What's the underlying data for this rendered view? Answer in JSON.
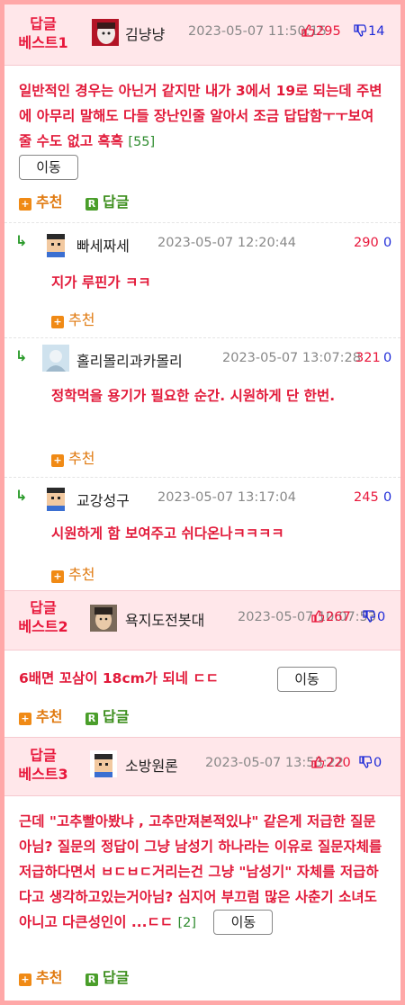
{
  "best1": {
    "label": "답글\n베스트1",
    "nick": "김냥냥",
    "time": "2023-05-07 11:50:15",
    "up": "295",
    "down": "14",
    "text": "일반적인 경우는 아닌거 같지만 내가 3에서 19로 되는데 주변에 아무리 말해도 다들 장난인줄 알아서 조금 답답함ㅜㅜ보여줄 수도 없고 흑흑",
    "count": "[55]",
    "move": "이동",
    "rec": "추천",
    "reply": "답글"
  },
  "replies": [
    {
      "nick": "빠세짜세",
      "time": "2023-05-07 12:20:44",
      "up": "290",
      "down": "0",
      "text": "지가 루핀가 ㅋㅋ",
      "rec": "추천"
    },
    {
      "nick": "홀리몰리과카몰리",
      "time": "2023-05-07 13:07:28",
      "up": "321",
      "down": "0",
      "text": "정학먹을 용기가 필요한 순간. 시원하게 단 한번.",
      "rec": "추천"
    },
    {
      "nick": "교강성구",
      "time": "2023-05-07 13:17:04",
      "up": "245",
      "down": "0",
      "text": "시원하게 함 보여주고 쉬다온나ㅋㅋㅋㅋ",
      "rec": "추천"
    }
  ],
  "best2": {
    "label": "답글\n베스트2",
    "nick": "욕지도전봇대",
    "time": "2023-05-07 10:07:53",
    "up": "267",
    "down": "0",
    "text": "6배면 꼬삼이 18cm가 되네 ㄷㄷ",
    "move": "이동",
    "rec": "추천",
    "reply": "답글"
  },
  "best3": {
    "label": "답글\n베스트3",
    "nick": "소방원론",
    "time": "2023-05-07 13:53:22",
    "up": "220",
    "down": "0",
    "text": "근데 \"고추빨아봤냐 , 고추만져본적있냐\" 같은게 저급한 질문아님? 질문의 정답이 그냥 남성기 하나라는 이유로 질문자체를 저급하다면서 ㅂㄷㅂㄷ거리는건 그냥 \"남성기\" 자체를 저급하다고 생각하고있는거아님? 심지어 부끄럼 많은 사춘기 소녀도 아니고 다큰성인이 ...ㄷㄷ",
    "count": "[2]",
    "move": "이동",
    "rec": "추천",
    "reply": "답글"
  },
  "colors": {
    "frame": "#ffa8a8",
    "head_bg": "#ffe7ea",
    "accent_red": "#e21a3a",
    "down_blue": "#1f2bd8",
    "rec_orange": "#f08a15",
    "reply_green": "#4a9e2a"
  },
  "icons": {
    "thumb_up": "thumb-up-icon",
    "thumb_down": "thumb-down-icon",
    "reply_arrow": "reply-arrow-icon",
    "plus": "plus-icon",
    "r_badge": "reply-badge-icon"
  }
}
